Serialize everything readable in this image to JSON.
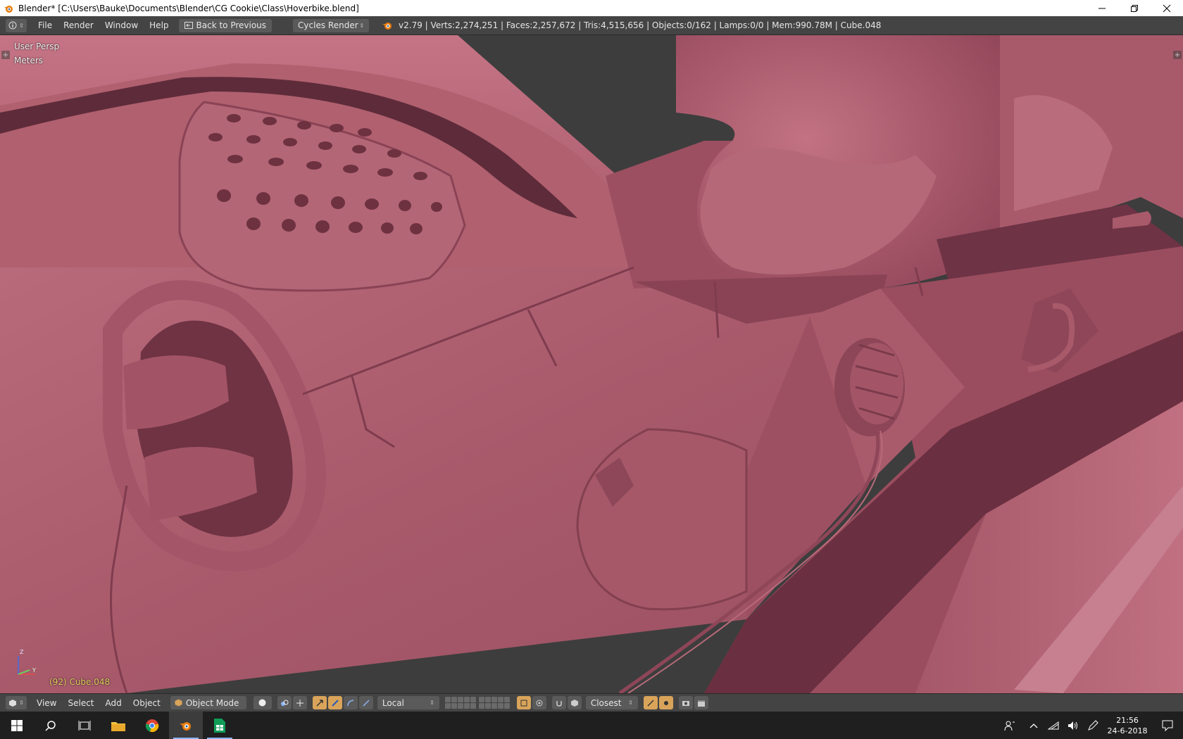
{
  "window": {
    "title": "Blender* [C:\\Users\\Bauke\\Documents\\Blender\\CG Cookie\\Class\\Hoverbike.blend]"
  },
  "info_header": {
    "menus": [
      "File",
      "Render",
      "Window",
      "Help"
    ],
    "back_button": "Back to Previous",
    "render_engine": "Cycles Render",
    "stats": "v2.79 | Verts:2,274,251 | Faces:2,257,672 | Tris:4,515,656 | Objects:0/162 | Lamps:0/0 | Mem:990.78M | Cube.048"
  },
  "viewport": {
    "view_name": "User Persp",
    "units": "Meters",
    "object_label": "(92) Cube.048",
    "axis_z": "Z",
    "axis_y": "Y",
    "mesh_color": "#b45f72",
    "background_color": "#3d3d3d"
  },
  "view_header": {
    "menus": [
      "View",
      "Select",
      "Add",
      "Object"
    ],
    "mode": "Object Mode",
    "pivot_orientation": "Local",
    "snap_target": "Closest"
  },
  "taskbar": {
    "time": "21:56",
    "date": "24-6-2018"
  },
  "icons": {
    "app": "blender-icon",
    "start": "windows-start-icon",
    "search": "search-icon",
    "task_view": "task-view-icon",
    "explorer": "file-explorer-icon",
    "chrome": "chrome-icon",
    "blender": "blender-icon",
    "sheets": "spreadsheet-icon"
  }
}
